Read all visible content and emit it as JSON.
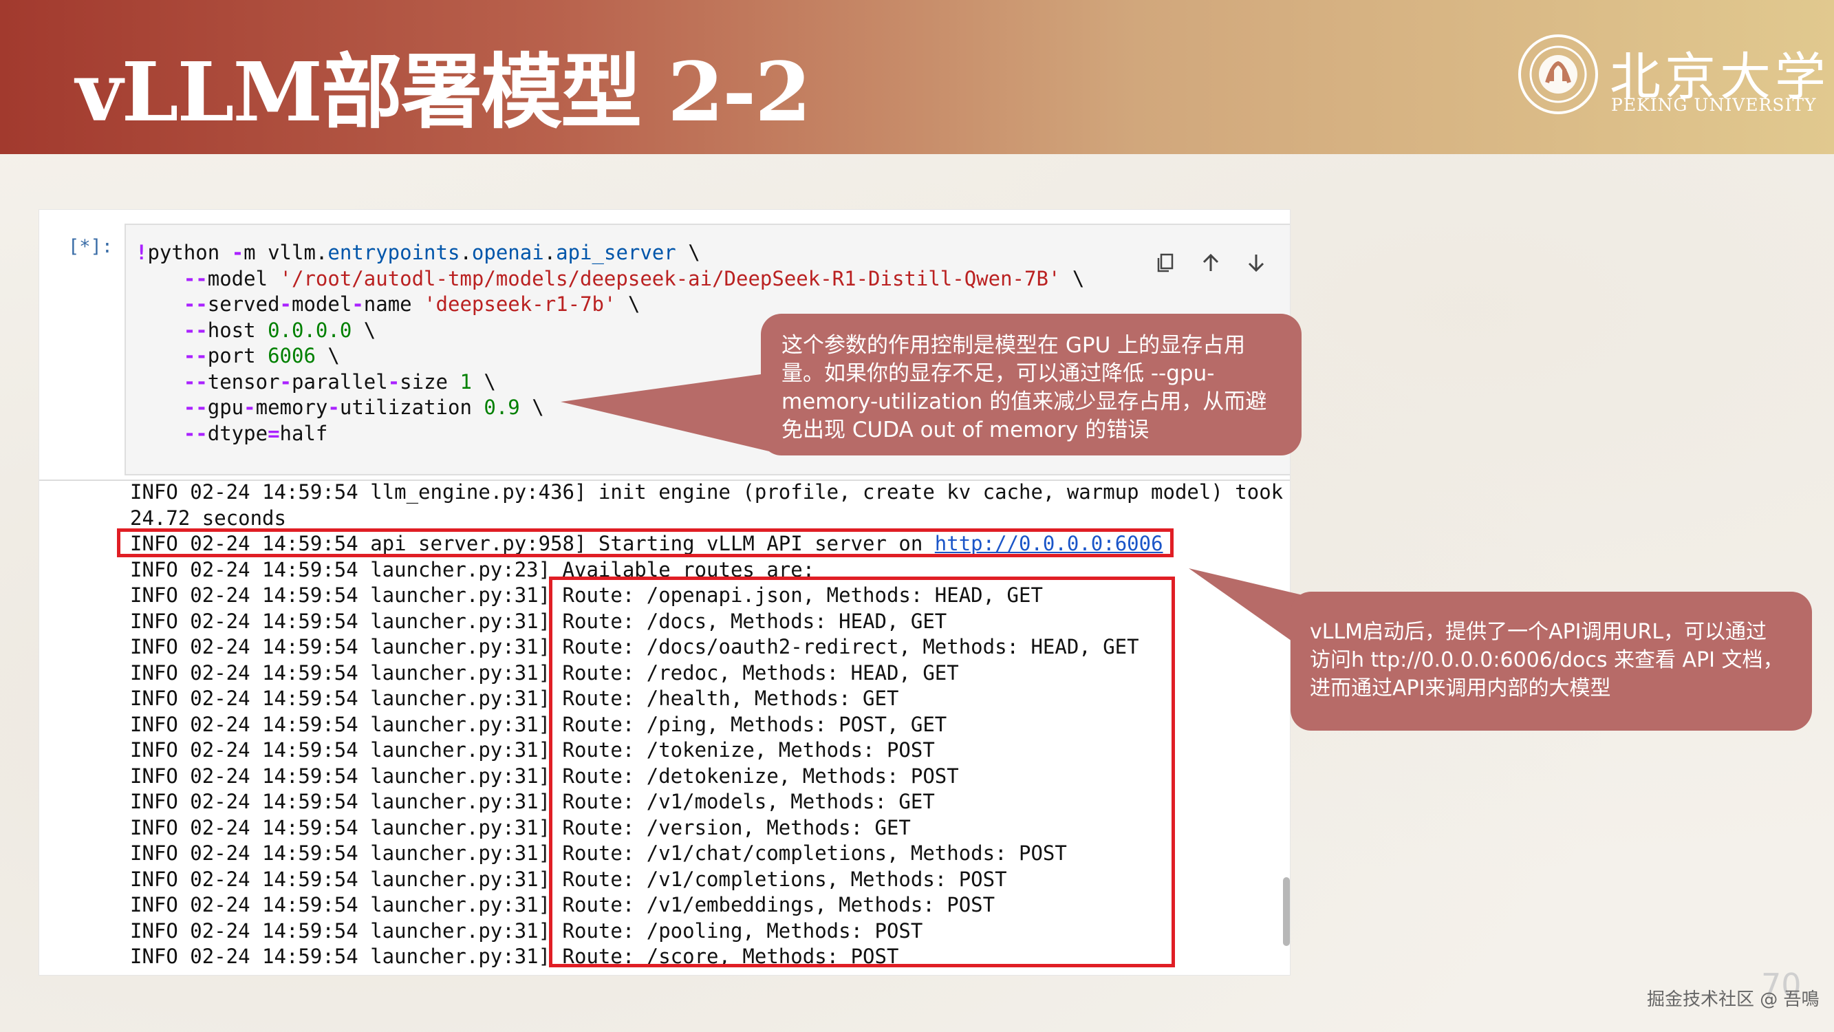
{
  "slide": {
    "title": "vLLM部署模型 2-2",
    "logo_cn": "北京大学",
    "logo_en": "PEKING UNIVERSITY",
    "page_number": "70",
    "footer": "掘金技术社区 @ 吾鳴"
  },
  "notebook": {
    "prompt": "[*]:",
    "code_lines": [
      "!python -m vllm.entrypoints.openai.api_server \\",
      "    --model '/root/autodl-tmp/models/deepseek-ai/DeepSeek-R1-Distill-Qwen-7B' \\",
      "    --served-model-name 'deepseek-r1-7b' \\",
      "    --host 0.0.0.0 \\",
      "    --port 6006 \\",
      "    --tensor-parallel-size 1 \\",
      "    --gpu-memory-utilization 0.9 \\",
      "    --dtype=half"
    ],
    "toolbar_icons": [
      "copy-icon",
      "move-up-icon",
      "move-down-icon",
      "insert-above-icon",
      "insert-below-icon",
      "delete-icon"
    ],
    "output_lines": [
      "INFO 02-24 14:59:54 llm_engine.py:436] init engine (profile, create kv cache, warmup model) took",
      "24.72 seconds",
      "INFO 02-24 14:59:54 api_server.py:958] Starting vLLM API server on ",
      "INFO 02-24 14:59:54 launcher.py:23] Available routes are:",
      "INFO 02-24 14:59:54 launcher.py:31] Route: /openapi.json, Methods: HEAD, GET",
      "INFO 02-24 14:59:54 launcher.py:31] Route: /docs, Methods: HEAD, GET",
      "INFO 02-24 14:59:54 launcher.py:31] Route: /docs/oauth2-redirect, Methods: HEAD, GET",
      "INFO 02-24 14:59:54 launcher.py:31] Route: /redoc, Methods: HEAD, GET",
      "INFO 02-24 14:59:54 launcher.py:31] Route: /health, Methods: GET",
      "INFO 02-24 14:59:54 launcher.py:31] Route: /ping, Methods: POST, GET",
      "INFO 02-24 14:59:54 launcher.py:31] Route: /tokenize, Methods: POST",
      "INFO 02-24 14:59:54 launcher.py:31] Route: /detokenize, Methods: POST",
      "INFO 02-24 14:59:54 launcher.py:31] Route: /v1/models, Methods: GET",
      "INFO 02-24 14:59:54 launcher.py:31] Route: /version, Methods: GET",
      "INFO 02-24 14:59:54 launcher.py:31] Route: /v1/chat/completions, Methods: POST",
      "INFO 02-24 14:59:54 launcher.py:31] Route: /v1/completions, Methods: POST",
      "INFO 02-24 14:59:54 launcher.py:31] Route: /v1/embeddings, Methods: POST",
      "INFO 02-24 14:59:54 launcher.py:31] Route: /pooling, Methods: POST",
      "INFO 02-24 14:59:54 launcher.py:31] Route: /score, Methods: POST"
    ],
    "server_url": "http://0.0.0.0:6006"
  },
  "callouts": {
    "gpu_memory": [
      "这个参数的作用控制是模型在 GPU 上的显存占用",
      "量。如果你的显存不足，可以通过降低 --gpu-",
      "memory-utilization 的值来减少显存占用，从而避",
      "免出现 CUDA out of memory 的错误"
    ],
    "api_url": [
      "vLLM启动后，提供了一个API调用URL，可以通过",
      "访问h ttp://0.0.0.0:6006/docs 来查看 API 文档，",
      "进而通过API来调用内部的大模型"
    ]
  },
  "colors": {
    "callout_bg": "#b76b68",
    "highlight_red": "#e01e25",
    "header_start": "#a23a2e",
    "header_end": "#e1c98f"
  }
}
